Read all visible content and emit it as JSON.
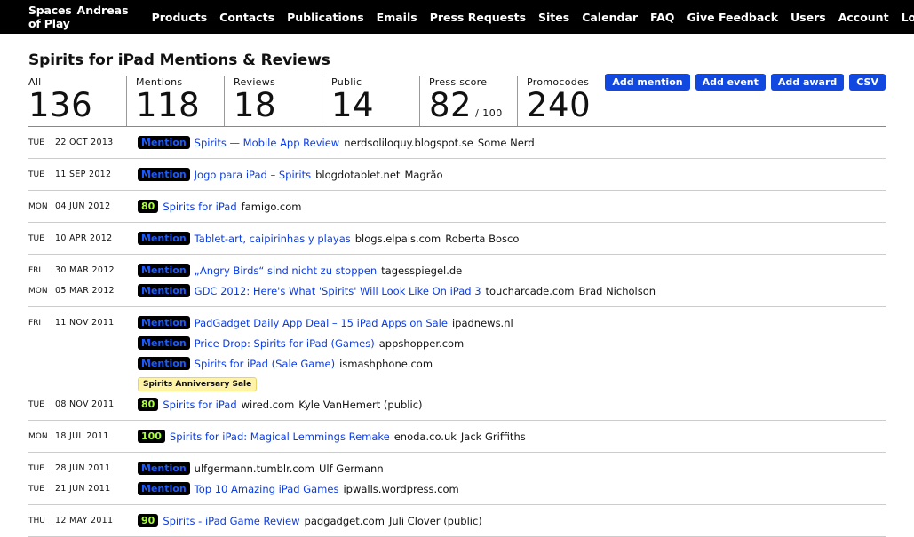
{
  "topbar": {
    "brand": "Spaces of Play",
    "user": "Andreas",
    "nav": [
      "Products",
      "Contacts",
      "Publications",
      "Emails",
      "Press Requests",
      "Sites",
      "Calendar"
    ],
    "right": [
      "FAQ",
      "Give Feedback",
      "Users",
      "Account",
      "Logout"
    ]
  },
  "page": {
    "title": "Spirits for iPad Mentions & Reviews"
  },
  "stats": [
    {
      "label": "All",
      "value": "136"
    },
    {
      "label": "Mentions",
      "value": "118"
    },
    {
      "label": "Reviews",
      "value": "18"
    },
    {
      "label": "Public",
      "value": "14"
    },
    {
      "label": "Press score",
      "value": "82",
      "suffix": "/ 100"
    },
    {
      "label": "Promocodes",
      "value": "240"
    }
  ],
  "actions": [
    "Add mention",
    "Add event",
    "Add award",
    "CSV"
  ],
  "groups": [
    {
      "rows": [
        {
          "day": "TUE",
          "date": "22 OCT 2013",
          "kind": "Mention",
          "title": "Spirits — Mobile App Review",
          "site": "nerdsoliloquy.blogspot.se",
          "author": "Some Nerd"
        }
      ]
    },
    {
      "rows": [
        {
          "day": "TUE",
          "date": "11 SEP 2012",
          "kind": "Mention",
          "title": "Jogo para iPad – Spirits",
          "site": "blogdotablet.net",
          "author": "Magrão"
        }
      ]
    },
    {
      "rows": [
        {
          "day": "MON",
          "date": "04 JUN 2012",
          "score": "80",
          "title": "Spirits for iPad",
          "site": "famigo.com",
          "author": ""
        }
      ]
    },
    {
      "rows": [
        {
          "day": "TUE",
          "date": "10 APR 2012",
          "kind": "Mention",
          "title": "Tablet-art, caipirinhas y playas",
          "site": "blogs.elpais.com",
          "author": "Roberta Bosco"
        }
      ]
    },
    {
      "rows": [
        {
          "day": "FRI",
          "date": "30 MAR 2012",
          "kind": "Mention",
          "title": "„Angry Birds“ sind nicht zu stoppen",
          "site": "tagesspiegel.de",
          "author": ""
        },
        {
          "day": "MON",
          "date": "05 MAR 2012",
          "kind": "Mention",
          "title": "GDC 2012: Here's What 'Spirits' Will Look Like On iPad 3",
          "site": "toucharcade.com",
          "author": "Brad Nicholson"
        }
      ]
    },
    {
      "rows": [
        {
          "day": "FRI",
          "date": "11 NOV 2011",
          "kind": "Mention",
          "title": "PadGadget Daily App Deal – 15 iPad Apps on Sale",
          "site": "ipadnews.nl",
          "author": ""
        },
        {
          "day": "",
          "date": "",
          "kind": "Mention",
          "title": "Price Drop: Spirits for iPad (Games)",
          "site": "appshopper.com",
          "author": ""
        },
        {
          "day": "",
          "date": "",
          "kind": "Mention",
          "title": "Spirits for iPad (Sale Game)",
          "site": "ismashphone.com",
          "author": ""
        },
        {
          "event": "Spirits Anniversary Sale"
        },
        {
          "day": "TUE",
          "date": "08 NOV 2011",
          "score": "80",
          "title": "Spirits for iPad",
          "site": "wired.com",
          "author": "Kyle VanHemert (public)"
        }
      ]
    },
    {
      "rows": [
        {
          "day": "MON",
          "date": "18 JUL 2011",
          "score": "100",
          "title": "Spirits for iPad: Magical Lemmings Remake",
          "site": "enoda.co.uk",
          "author": "Jack Griffiths"
        }
      ]
    },
    {
      "rows": [
        {
          "day": "TUE",
          "date": "28 JUN 2011",
          "kind": "Mention",
          "title": "",
          "site": "ulfgermann.tumblr.com",
          "author": "Ulf Germann"
        },
        {
          "day": "TUE",
          "date": "21 JUN 2011",
          "kind": "Mention",
          "title": "Top 10 Amazing iPad Games",
          "site": "ipwalls.wordpress.com",
          "author": ""
        }
      ]
    },
    {
      "rows": [
        {
          "day": "THU",
          "date": "12 MAY 2011",
          "score": "90",
          "title": "Spirits - iPad Game Review",
          "site": "padgadget.com",
          "author": "Juli Clover (public)"
        }
      ]
    }
  ]
}
